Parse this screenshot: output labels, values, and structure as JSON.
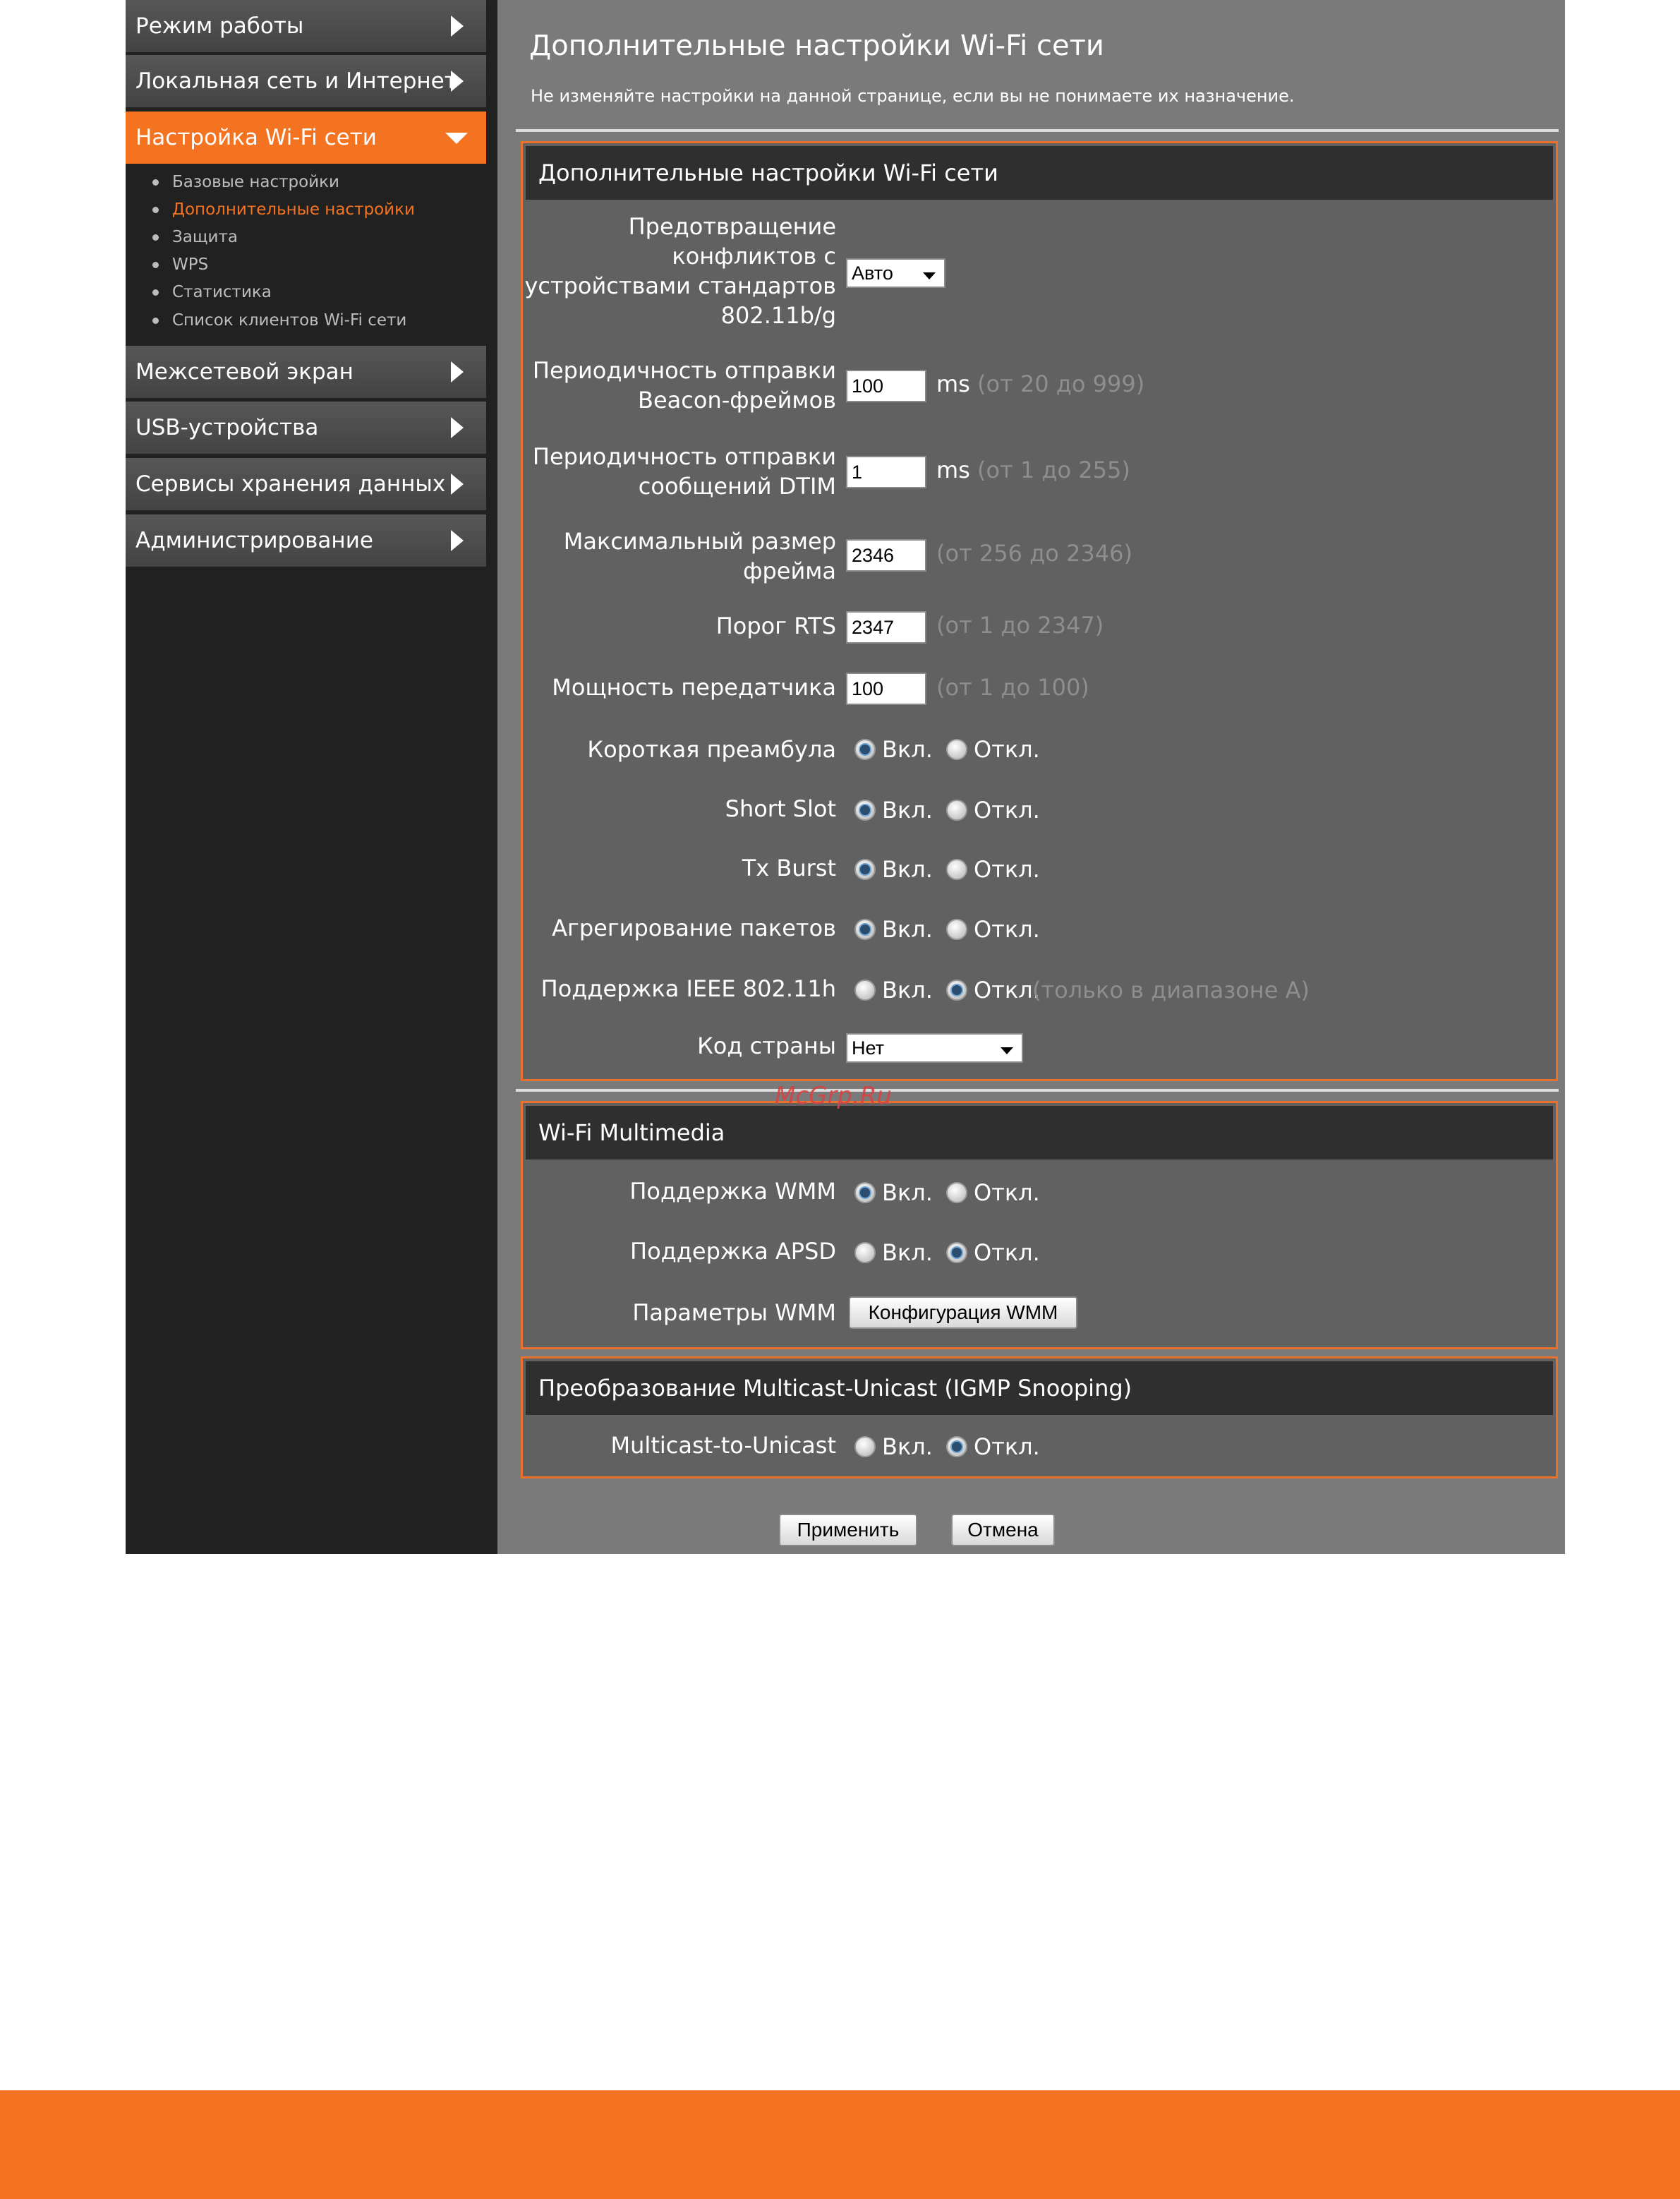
{
  "sidebar": {
    "items": [
      {
        "label": "Режим работы"
      },
      {
        "label": "Локальная сеть и Интернет"
      },
      {
        "label": "Настройка Wi-Fi сети"
      },
      {
        "label": "Межсетевой экран"
      },
      {
        "label": "USB-устройства"
      },
      {
        "label": "Сервисы хранения данных"
      },
      {
        "label": "Администрирование"
      }
    ],
    "subitems": [
      {
        "label": "Базовые настройки"
      },
      {
        "label": "Дополнительные настройки"
      },
      {
        "label": "Защита"
      },
      {
        "label": "WPS"
      },
      {
        "label": "Статистика"
      },
      {
        "label": "Список клиентов Wi-Fi сети"
      }
    ]
  },
  "page": {
    "title": "Дополнительные настройки Wi-Fi сети",
    "subtitle": "Не изменяйте настройки на данной странице, если вы не понимаете их назначение."
  },
  "advanced": {
    "header": "Дополнительные настройки Wi-Fi сети",
    "protection": {
      "label_lines": [
        "Предотвращение",
        "конфликтов с",
        "устройствами стандартов",
        "802.11b/g"
      ],
      "value": "Авто"
    },
    "beacon": {
      "label_lines": [
        "Периодичность отправки",
        "Beacon-фреймов"
      ],
      "value": "100",
      "unit": "ms",
      "hint": "(от 20 до 999)"
    },
    "dtim": {
      "label_lines": [
        "Периодичность отправки",
        "сообщений DTIM"
      ],
      "value": "1",
      "unit": "ms",
      "hint": "(от 1 до 255)"
    },
    "frag": {
      "label_lines": [
        "Максимальный размер",
        "фрейма"
      ],
      "value": "2346",
      "hint": "(от 256 до 2346)"
    },
    "rts": {
      "label": "Порог RTS",
      "value": "2347",
      "hint": "(от 1 до 2347)"
    },
    "txpower": {
      "label": "Мощность передатчика",
      "value": "100",
      "hint": "(от 1 до 100)"
    },
    "preamble": {
      "label": "Короткая преамбула",
      "selected": "on"
    },
    "shortslot": {
      "label": "Short Slot",
      "selected": "on"
    },
    "txburst": {
      "label": "Tx Burst",
      "selected": "on"
    },
    "aggregation": {
      "label": "Агрегирование пакетов",
      "selected": "on"
    },
    "ieee80211h": {
      "label": "Поддержка IEEE 802.11h",
      "selected": "off",
      "hint": "(только в диапазоне А)"
    },
    "country": {
      "label": "Код страны",
      "value": "Нет"
    }
  },
  "radio_labels": {
    "on": "Вкл.",
    "off": "Откл."
  },
  "wmm": {
    "header": "Wi-Fi Multimedia",
    "support": {
      "label": "Поддержка WMM",
      "selected": "on"
    },
    "apsd": {
      "label": "Поддержка APSD",
      "selected": "off"
    },
    "params": {
      "label": "Параметры WMM",
      "button": "Конфигурация WMM"
    }
  },
  "igmp": {
    "header": "Преобразование Multicast-Unicast (IGMP Snooping)",
    "m2u": {
      "label": "Multicast-to-Unicast",
      "selected": "off"
    }
  },
  "actions": {
    "apply": "Применить",
    "cancel": "Отмена"
  },
  "watermark": "McGrp.Ru",
  "colors": {
    "accent": "#f37321",
    "sidebar_bg": "#212121",
    "main_bg": "#7a7a7a",
    "section_bg": "#616161"
  }
}
